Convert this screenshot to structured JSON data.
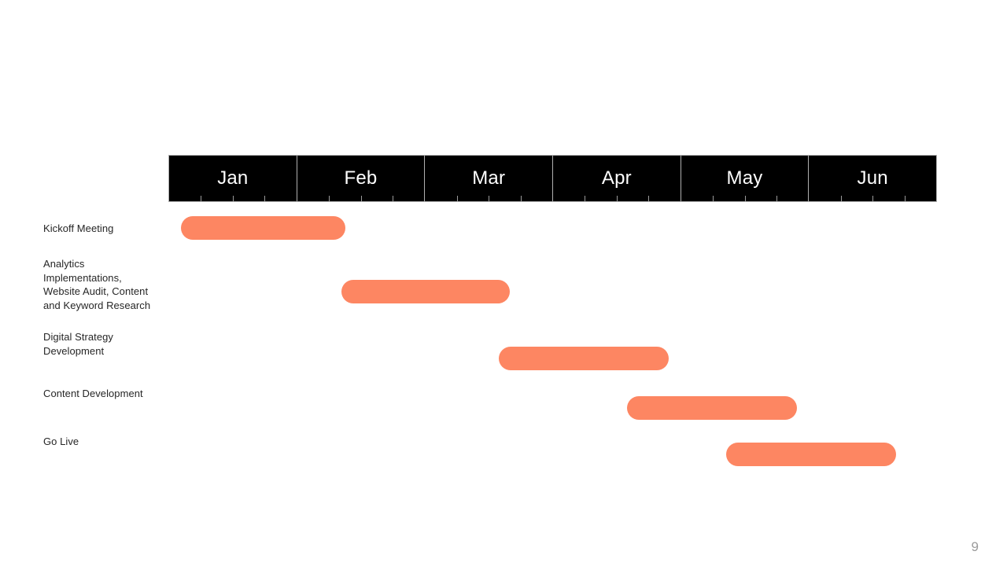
{
  "slide": {
    "number": "9",
    "accent_color": "#fd8662",
    "header_background": "#000000",
    "header_text_color": "#ffffff",
    "label_text_color": "#262626",
    "slide_number_color": "#9b9b9b",
    "background_color": "#ffffff"
  },
  "chart_data": {
    "type": "bar",
    "chart_subtype": "gantt",
    "title": "",
    "xlabel": "",
    "ylabel": "",
    "grid": false,
    "legend_position": "none",
    "axis_orientation": "horizontal-time",
    "timeline": {
      "unit": "month",
      "ticks_per_unit": 4,
      "categories": [
        "Jan",
        "Feb",
        "Mar",
        "Apr",
        "May",
        "Jun"
      ],
      "start_index": 0,
      "end_index": 6
    },
    "categories": [
      "Kickoff Meeting",
      "Analytics Implementations, Website Audit, Content and Keyword Research",
      "Digital Strategy Development",
      "Content Development",
      "Go Live"
    ],
    "tasks": [
      {
        "label": "Kickoff Meeting",
        "label_lines": [
          "Kickoff Meeting"
        ],
        "start_month": "Jan",
        "end_month": "Feb",
        "start_value": 0.1,
        "end_value": 1.38,
        "duration": 1.28,
        "color": "#fd8662"
      },
      {
        "label": "Analytics Implementations, Website Audit, Content and Keyword Research",
        "label_lines": [
          "Analytics",
          "Implementations,",
          "Website Audit, Content",
          "and Keyword Research"
        ],
        "start_month": "Feb",
        "end_month": "Mar",
        "start_value": 1.35,
        "end_value": 2.66,
        "duration": 1.31,
        "color": "#fd8662"
      },
      {
        "label": "Digital Strategy Development",
        "label_lines": [
          "Digital Strategy",
          "Development"
        ],
        "start_month": "Mar",
        "end_month": "Apr",
        "start_value": 2.58,
        "end_value": 3.9,
        "duration": 1.32,
        "color": "#fd8662"
      },
      {
        "label": "Content Development",
        "label_lines": [
          "Content Development"
        ],
        "start_month": "Apr",
        "end_month": "May",
        "start_value": 3.58,
        "end_value": 4.9,
        "duration": 1.32,
        "color": "#fd8662"
      },
      {
        "label": "Go Live",
        "label_lines": [
          "Go Live"
        ],
        "start_month": "May",
        "end_month": "Jun",
        "start_value": 4.35,
        "end_value": 5.68,
        "duration": 1.33,
        "color": "#fd8662"
      }
    ]
  }
}
